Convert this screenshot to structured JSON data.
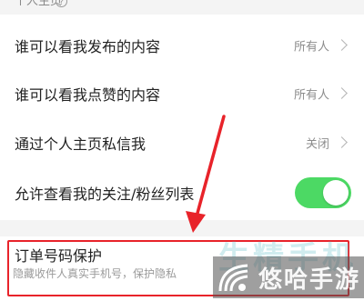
{
  "section": {
    "title": "个人主页",
    "help_icon": "question-circle-icon"
  },
  "rows": [
    {
      "label": "谁可以看我发布的内容",
      "value": "所有人",
      "control": "chevron"
    },
    {
      "label": "谁可以看我点赞的内容",
      "value": "所有人",
      "control": "chevron"
    },
    {
      "label": "通过个人主页私信我",
      "value": "关闭",
      "control": "chevron"
    },
    {
      "label": "允许查看我的关注/粉丝列表",
      "control": "toggle",
      "toggle_on": true
    }
  ],
  "order_protection": {
    "title": "订单号码保护",
    "description": "隐藏收件人真实手机号，保护隐私"
  },
  "colors": {
    "toggle_on": "#4cd964",
    "highlight": "#e8232a"
  },
  "watermark": {
    "text": "悠哈手游",
    "background_text": "生精手机"
  }
}
